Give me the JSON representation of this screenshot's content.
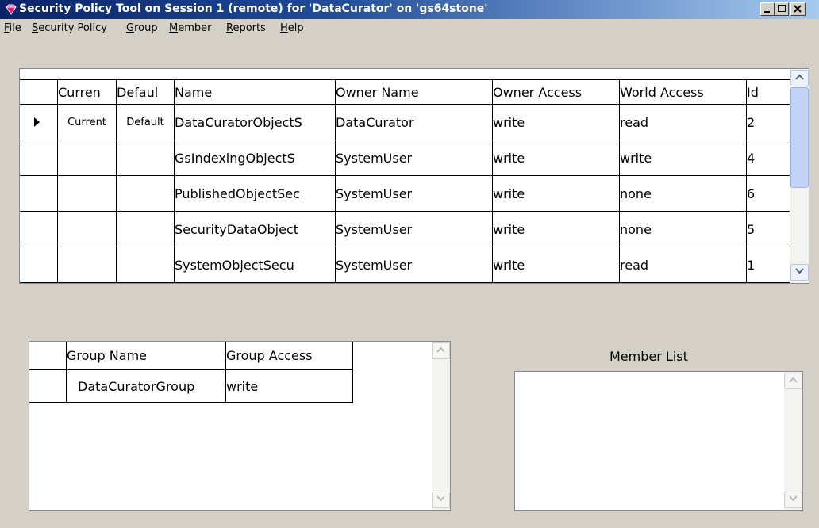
{
  "window": {
    "title": "Security Policy Tool on Session 1 (remote) for 'DataCurator' on 'gs64stone'",
    "controls": [
      "minimize",
      "maximize",
      "close"
    ]
  },
  "menubar": {
    "items": [
      {
        "label": "File",
        "mnemonic": "F",
        "rest": "ile"
      },
      {
        "label": "Security Policy",
        "mnemonic": "S",
        "rest": "ecurity Policy"
      },
      {
        "label": "Group",
        "mnemonic": "G",
        "rest": "roup"
      },
      {
        "label": "Member",
        "mnemonic": "M",
        "rest": "ember"
      },
      {
        "label": "Reports",
        "mnemonic": "R",
        "rest": "eports"
      },
      {
        "label": "Help",
        "mnemonic": "H",
        "rest": "elp"
      }
    ]
  },
  "policy_table": {
    "columns": [
      "",
      "Curren",
      "Defaul",
      "Name",
      "Owner Name",
      "Owner Access",
      "World Access",
      "Id"
    ],
    "rows": [
      {
        "current": "Current",
        "default": "Default",
        "name": "DataCuratorObjectS",
        "owner_name": "DataCurator",
        "owner_access": "write",
        "world_access": "read",
        "id": "2",
        "selected": true
      },
      {
        "current": "",
        "default": "",
        "name": "GsIndexingObjectS",
        "owner_name": "SystemUser",
        "owner_access": "write",
        "world_access": "write",
        "id": "4",
        "selected": false
      },
      {
        "current": "",
        "default": "",
        "name": "PublishedObjectSec",
        "owner_name": "SystemUser",
        "owner_access": "write",
        "world_access": "none",
        "id": "6",
        "selected": false
      },
      {
        "current": "",
        "default": "",
        "name": "SecurityDataObject",
        "owner_name": "SystemUser",
        "owner_access": "write",
        "world_access": "none",
        "id": "5",
        "selected": false
      },
      {
        "current": "",
        "default": "",
        "name": "SystemObjectSecu",
        "owner_name": "SystemUser",
        "owner_access": "write",
        "world_access": "read",
        "id": "1",
        "selected": false
      }
    ]
  },
  "group_table": {
    "columns": [
      "",
      "Group Name",
      "Group Access"
    ],
    "rows": [
      {
        "group_name": "DataCuratorGroup",
        "group_access": "write"
      }
    ]
  },
  "member_list": {
    "label": "Member List",
    "items": []
  },
  "colors": {
    "titlebar_start": "#0a246a",
    "titlebar_end": "#a6caf0",
    "window_bg": "#d4d0c8",
    "app_icon": "#d4167a"
  }
}
